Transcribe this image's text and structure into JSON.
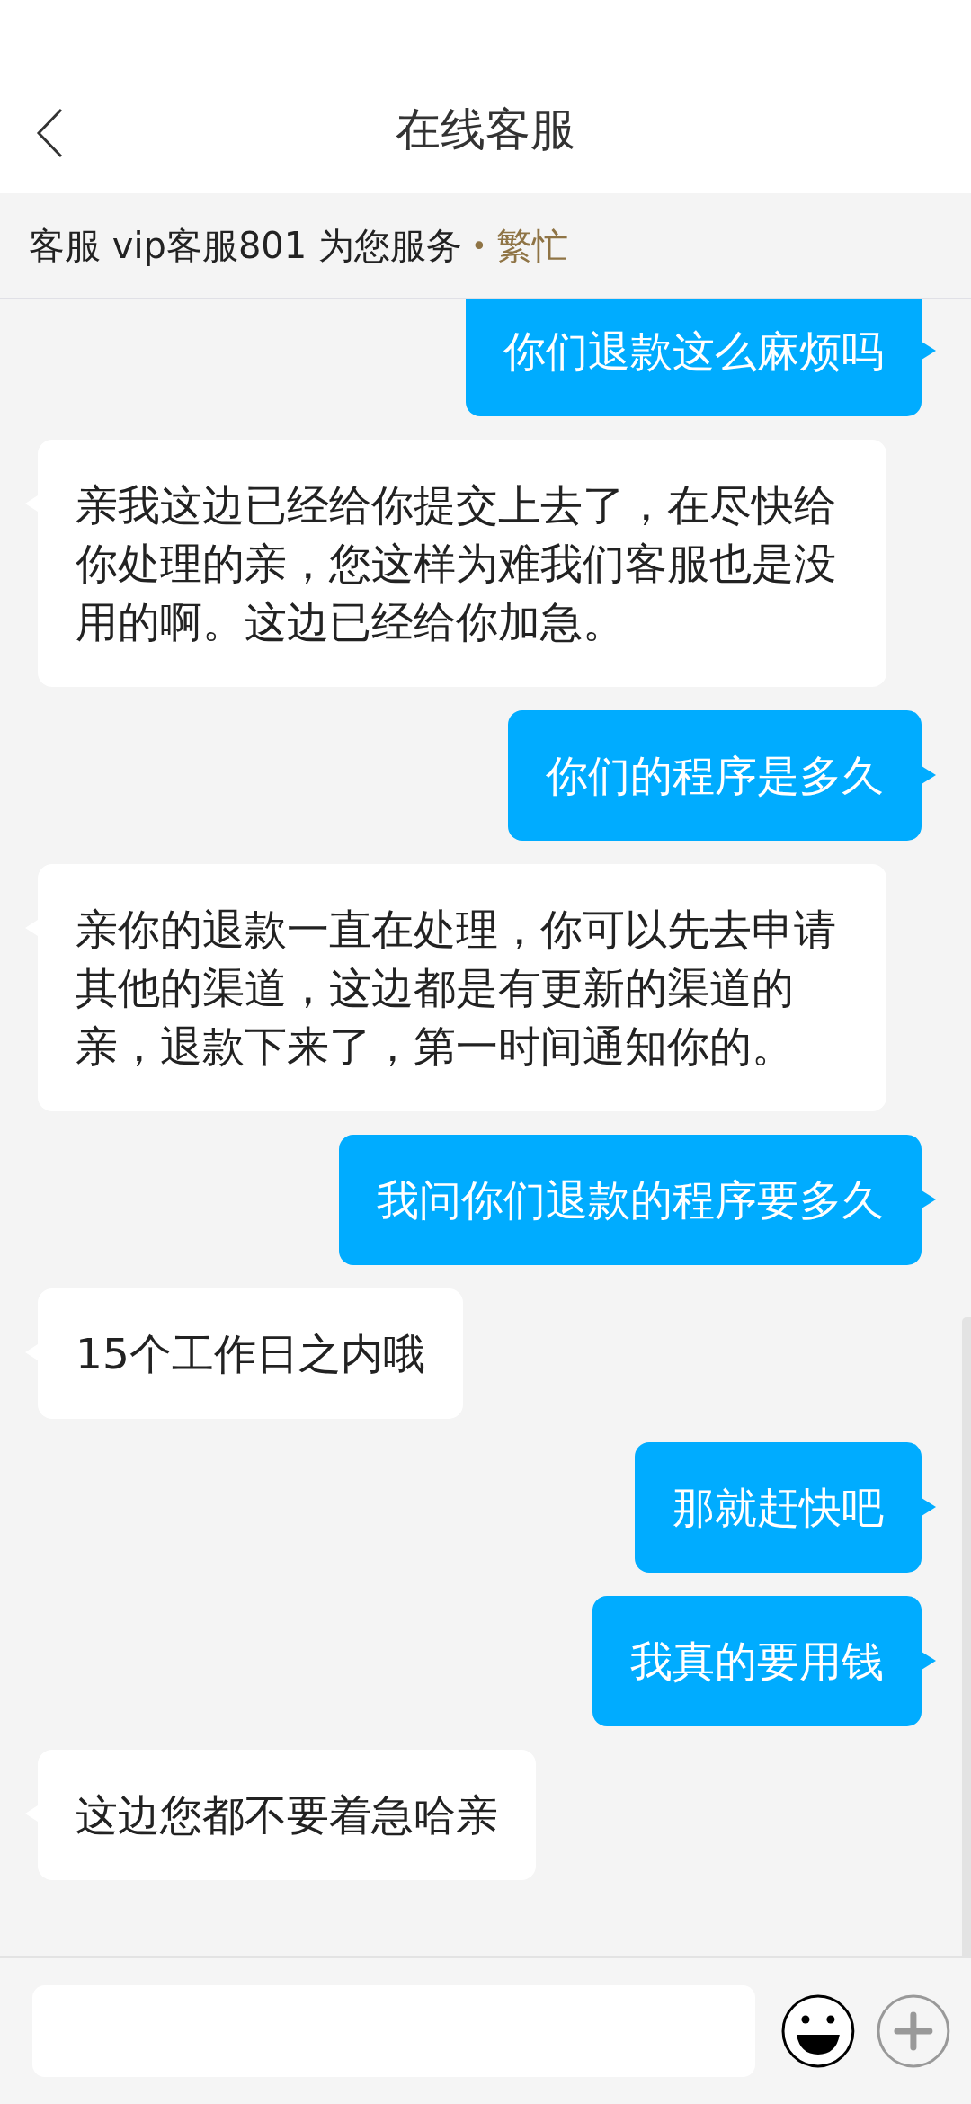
{
  "header": {
    "title": "在线客服"
  },
  "service_bar": {
    "text": "客服 vip客服801 为您服务",
    "separator": "•",
    "status": "繁忙"
  },
  "messages": [
    {
      "kind": "user",
      "text": "你们退款这么麻烦吗"
    },
    {
      "kind": "agent",
      "text": "亲我这边已经给你提交上去了，在尽快给你处理的亲，您这样为难我们客服也是没用的啊。这边已经给你加急。"
    },
    {
      "kind": "user",
      "text": "你们的程序是多久"
    },
    {
      "kind": "agent",
      "text": "亲你的退款一直在处理，你可以先去申请其他的渠道，这边都是有更新的渠道的亲，退款下来了，第一时间通知你的。"
    },
    {
      "kind": "user",
      "text": "我问你们退款的程序要多久"
    },
    {
      "kind": "agent",
      "text": "15个工作日之内哦"
    },
    {
      "kind": "user",
      "text": "那就赶快吧"
    },
    {
      "kind": "user",
      "text": "我真的要用钱"
    },
    {
      "kind": "agent",
      "text": "这边您都不要着急哈亲"
    }
  ]
}
